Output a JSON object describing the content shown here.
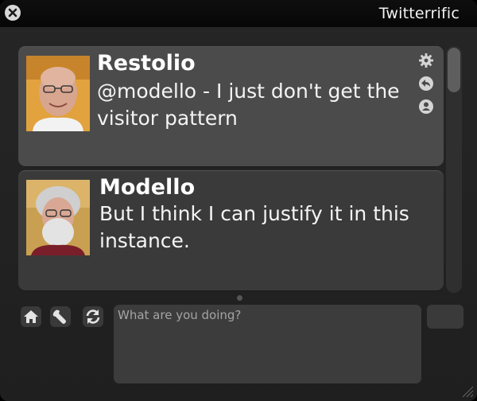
{
  "app": {
    "title": "Twitterrific"
  },
  "tweets": [
    {
      "username": "Restolio",
      "text": "@modello - I just don't get the visitor pattern",
      "selected": true
    },
    {
      "username": "Modello",
      "text": "But I think I can justify it in this instance.",
      "selected": false
    }
  ],
  "tweet_actions": [
    "gear-icon",
    "reply-icon",
    "profile-icon"
  ],
  "toolbar": {
    "buttons": [
      "home-icon",
      "wrench-icon",
      "refresh-icon"
    ]
  },
  "compose": {
    "placeholder": "What are you doing?",
    "value": ""
  },
  "colors": {
    "window_bg": "#232323",
    "selected_tweet_bg": "#4b4b4b",
    "tweet_bg": "#3a3a3a",
    "text": "#ffffff"
  }
}
